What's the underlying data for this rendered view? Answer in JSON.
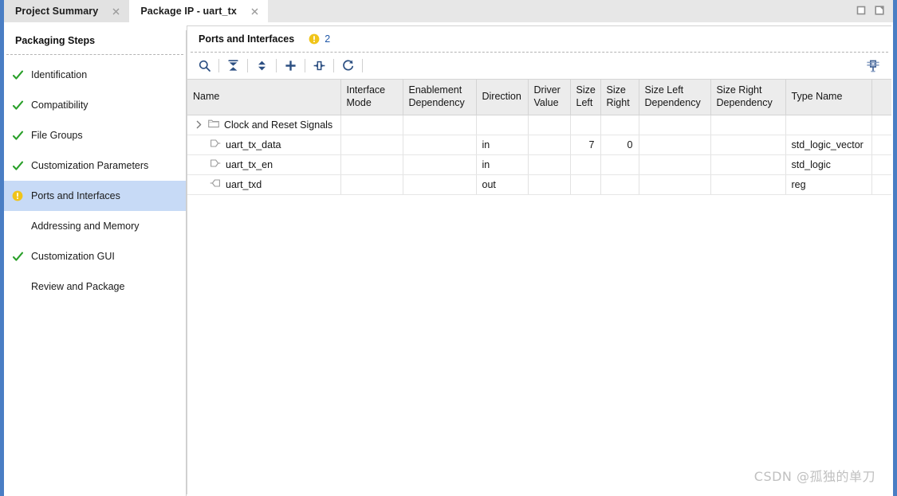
{
  "window": {
    "controls": [
      {
        "name": "maximize-restore",
        "label": "Maximize"
      },
      {
        "name": "float",
        "label": "Float"
      }
    ]
  },
  "tabs": [
    {
      "label": "Project Summary",
      "active": false,
      "closable": true
    },
    {
      "label": "Package IP - uart_tx",
      "active": true,
      "closable": true
    }
  ],
  "sidebar": {
    "title": "Packaging Steps",
    "items": [
      {
        "label": "Identification",
        "status": "done",
        "selected": false
      },
      {
        "label": "Compatibility",
        "status": "done",
        "selected": false
      },
      {
        "label": "File Groups",
        "status": "done",
        "selected": false
      },
      {
        "label": "Customization Parameters",
        "status": "done",
        "selected": false
      },
      {
        "label": "Ports and Interfaces",
        "status": "warning",
        "selected": true
      },
      {
        "label": "Addressing and Memory",
        "status": "none",
        "selected": false
      },
      {
        "label": "Customization GUI",
        "status": "done",
        "selected": false
      },
      {
        "label": "Review and Package",
        "status": "none",
        "selected": false
      }
    ]
  },
  "panel": {
    "title": "Ports and Interfaces",
    "warning_count": "2",
    "toolbar": [
      {
        "name": "search-icon",
        "tooltip": "Search"
      },
      {
        "name": "collapse-all-icon",
        "tooltip": "Collapse All"
      },
      {
        "name": "expand-all-icon",
        "tooltip": "Expand All"
      },
      {
        "name": "add-icon",
        "tooltip": "Add Interface"
      },
      {
        "name": "auto-infer-icon",
        "tooltip": "Auto Infer Interface"
      },
      {
        "name": "refresh-icon",
        "tooltip": "Refresh"
      }
    ],
    "settings_icon": "column-settings-icon"
  },
  "table": {
    "columns": [
      {
        "key": "name",
        "label": "Name"
      },
      {
        "key": "interface_mode",
        "label": "Interface Mode"
      },
      {
        "key": "enablement_dependency",
        "label": "Enablement Dependency"
      },
      {
        "key": "direction",
        "label": "Direction"
      },
      {
        "key": "driver_value",
        "label": "Driver Value"
      },
      {
        "key": "size_left",
        "label": "Size Left"
      },
      {
        "key": "size_right",
        "label": "Size Right"
      },
      {
        "key": "size_left_dependency",
        "label": "Size Left Dependency"
      },
      {
        "key": "size_right_dependency",
        "label": "Size Right Dependency"
      },
      {
        "key": "type_name",
        "label": "Type Name"
      },
      {
        "key": "spare",
        "label": ""
      }
    ],
    "rows": [
      {
        "kind": "group",
        "expanded": false,
        "icon": "folder-icon",
        "name": "Clock and Reset Signals",
        "interface_mode": "",
        "enablement_dependency": "",
        "direction": "",
        "driver_value": "",
        "size_left": "",
        "size_right": "",
        "size_left_dependency": "",
        "size_right_dependency": "",
        "type_name": ""
      },
      {
        "kind": "port",
        "icon": "port-in-icon",
        "name": "uart_tx_data",
        "interface_mode": "",
        "enablement_dependency": "",
        "direction": "in",
        "driver_value": "",
        "size_left": "7",
        "size_right": "0",
        "size_left_dependency": "",
        "size_right_dependency": "",
        "type_name": "std_logic_vector"
      },
      {
        "kind": "port",
        "icon": "port-in-icon",
        "name": "uart_tx_en",
        "interface_mode": "",
        "enablement_dependency": "",
        "direction": "in",
        "driver_value": "",
        "size_left": "",
        "size_right": "",
        "size_left_dependency": "",
        "size_right_dependency": "",
        "type_name": "std_logic"
      },
      {
        "kind": "port",
        "icon": "port-out-icon",
        "name": "uart_txd",
        "interface_mode": "",
        "enablement_dependency": "",
        "direction": "out",
        "driver_value": "",
        "size_left": "",
        "size_right": "",
        "size_left_dependency": "",
        "size_right_dependency": "",
        "type_name": "reg"
      }
    ]
  },
  "watermark": "CSDN @孤独的单刀",
  "colors": {
    "accent_blue": "#4a7ec4",
    "selection_blue": "#c7daf6",
    "check_green": "#2aa02a",
    "warning_yellow": "#f0c419",
    "icon_navy": "#2c4f82",
    "link_blue": "#2058a8"
  }
}
